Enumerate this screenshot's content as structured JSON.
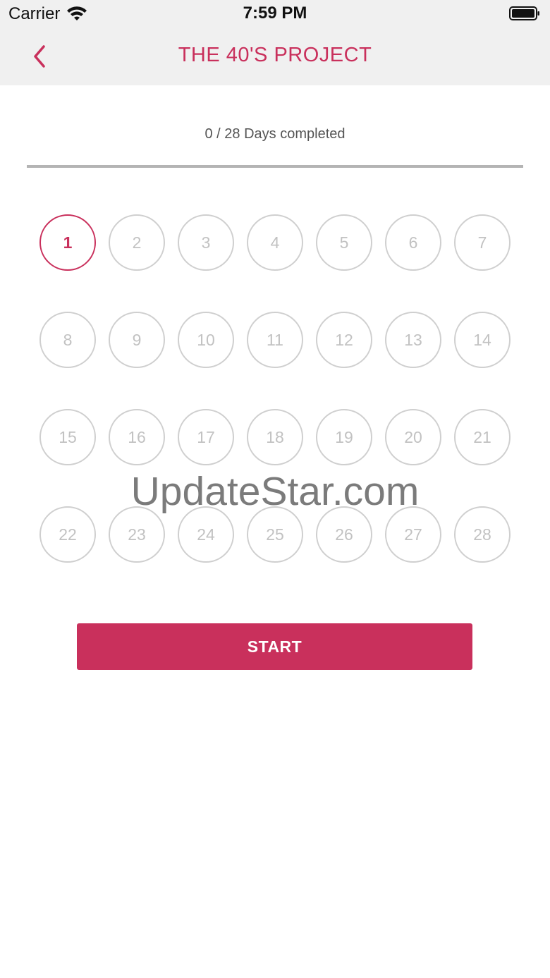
{
  "status_bar": {
    "carrier": "Carrier",
    "time": "7:59 PM",
    "icons": [
      "wifi-icon",
      "battery-icon"
    ]
  },
  "nav": {
    "back_icon": "chevron-left-icon",
    "title": "THE 40'S PROJECT"
  },
  "progress": {
    "label": "0 / 28 Days completed",
    "completed": 0,
    "total": 28
  },
  "days": [
    "1",
    "2",
    "3",
    "4",
    "5",
    "6",
    "7",
    "8",
    "9",
    "10",
    "11",
    "12",
    "13",
    "14",
    "15",
    "16",
    "17",
    "18",
    "19",
    "20",
    "21",
    "22",
    "23",
    "24",
    "25",
    "26",
    "27",
    "28"
  ],
  "active_day": "1",
  "watermark": "UpdateStar.com",
  "start_button": {
    "label": "START"
  },
  "colors": {
    "accent": "#c9305c",
    "header_bg": "#f0f0f0",
    "circle_border": "#cfcfcf",
    "circle_text": "#c2c2c2",
    "progress_track": "#b4b4b4"
  }
}
